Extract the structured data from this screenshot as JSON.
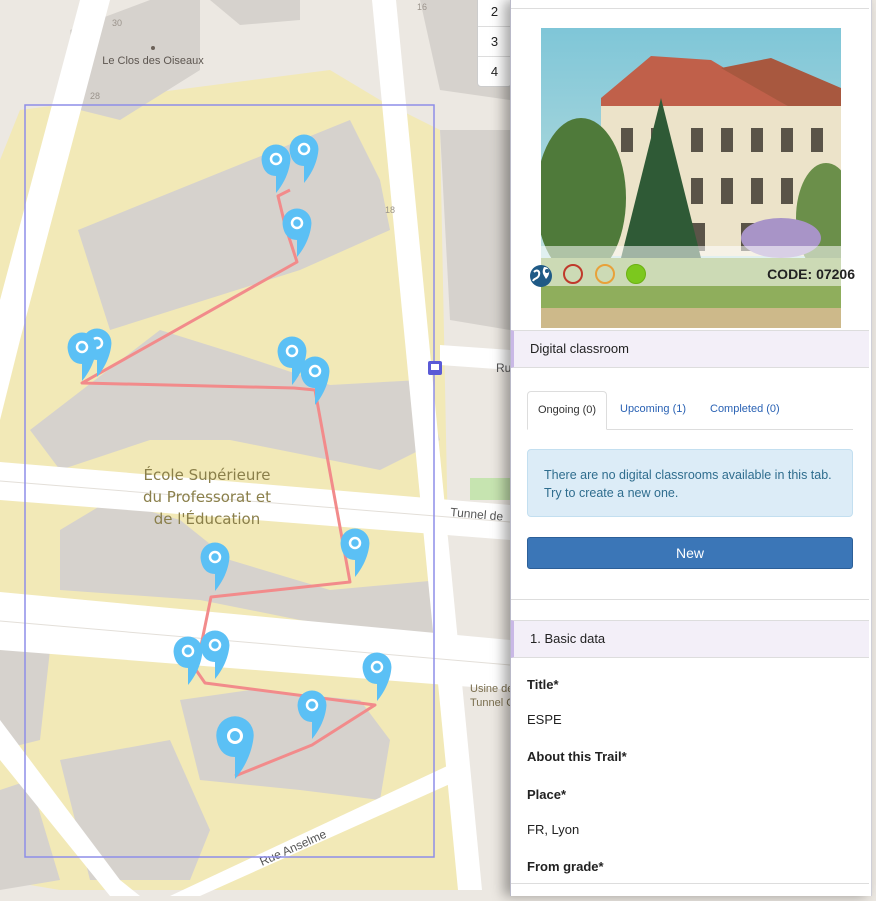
{
  "map": {
    "labels": {
      "place": "Le Clos des Oiseaux",
      "school_line1": "École Supérieure",
      "school_line2": "du Professorat et",
      "school_line3": "de l'Éducation",
      "tunnel1": "Tunnel de",
      "usine_line1": "Usine de",
      "usine_line2": "Tunnel C",
      "street_anselme": "Rue Anselme",
      "street_ru": "Ru",
      "num_30": "30",
      "num_28": "28",
      "num_18": "18",
      "num_16": "16"
    },
    "zoom_levels": [
      "2",
      "3",
      "4"
    ],
    "colors": {
      "route": "#f28b8b",
      "marker": "#5bc0f5",
      "bbox": "#8e8ee8",
      "campus": "#f2e9b7",
      "building": "#d6d2cd"
    }
  },
  "panel": {
    "photo_alt_icon": "building-photo",
    "status_icons": [
      "globe-pin-icon",
      "red-circle-icon",
      "orange-circle-icon",
      "green-circle-icon"
    ],
    "status_colors": [
      "#c0392b",
      "#e8a13a",
      "#7cc81e"
    ],
    "code_label": "CODE: 07206",
    "digital_classroom": {
      "header": "Digital classroom",
      "tabs": [
        "Ongoing (0)",
        "Upcoming (1)",
        "Completed (0)"
      ],
      "alert_text": "There are no digital classrooms available in this tab. Try to create a new one.",
      "new_button": "New"
    },
    "basic_data": {
      "header": "1. Basic data",
      "title_label": "Title*",
      "title_value": "ESPE",
      "about_label": "About this Trail*",
      "place_label": "Place*",
      "place_value": "FR, Lyon",
      "grade_label": "From grade*"
    }
  }
}
